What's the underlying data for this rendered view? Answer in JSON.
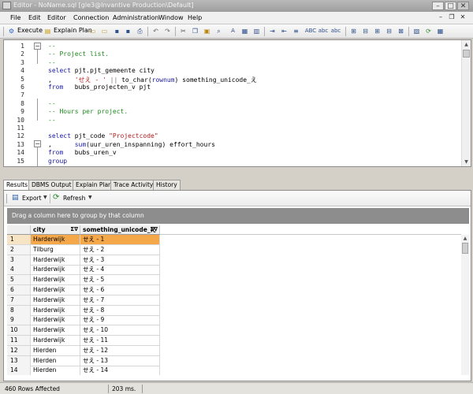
{
  "window": {
    "title": "Editor - NoName.sql [gle3@Invantive Production\\Default]"
  },
  "menu": [
    "File",
    "Edit",
    "Editor",
    "Connection",
    "Administration",
    "Window",
    "Help"
  ],
  "toolbar": {
    "execute_label": "Execute",
    "explain_label": "Explain Plan"
  },
  "editor": {
    "lines": [
      {
        "n": "1",
        "html": "<span class='cm'>--</span>"
      },
      {
        "n": "2",
        "html": "<span class='cm'>-- Project list.</span>"
      },
      {
        "n": "3",
        "html": "<span class='cm'>--</span>"
      },
      {
        "n": "4",
        "html": "<span class='kw'>select</span> pjt.pjt_gemeente city"
      },
      {
        "n": "5",
        "html": ",      <span class='st'>'せえ - '</span> <span class='op'>||</span> to_char(<span class='kw'>rownum</span>) something_unicode_え"
      },
      {
        "n": "6",
        "html": "<span class='kw'>from</span>   bubs_projecten_v pjt"
      },
      {
        "n": "7",
        "html": ""
      },
      {
        "n": "8",
        "html": "<span class='cm'>--</span>"
      },
      {
        "n": "9",
        "html": "<span class='cm'>-- Hours per project.</span>"
      },
      {
        "n": "10",
        "html": "<span class='cm'>--</span>"
      },
      {
        "n": "11",
        "html": ""
      },
      {
        "n": "12",
        "html": "<span class='kw'>select</span> pjt_code <span class='st'>\"Projectcode\"</span>"
      },
      {
        "n": "13",
        "html": ",      <span class='kw'>sum</span>(uur_uren_inspanning) effort_hours"
      },
      {
        "n": "14",
        "html": "<span class='kw'>from</span>   bubs_uren_v"
      },
      {
        "n": "15",
        "html": "<span class='kw'>group</span>"
      }
    ]
  },
  "tabs": [
    "Results",
    "DBMS Output",
    "Explain Plan",
    "Trace Activity",
    "History"
  ],
  "results": {
    "export_label": "Export",
    "refresh_label": "Refresh",
    "groupby_hint": "Drag a column here to group by that column",
    "columns": [
      "city",
      "something_unicode_え"
    ],
    "rows": [
      {
        "idx": "1",
        "city": "Harderwijk",
        "uni": "せえ - 1"
      },
      {
        "idx": "2",
        "city": "Tilburg",
        "uni": "せえ - 2"
      },
      {
        "idx": "3",
        "city": "Harderwijk",
        "uni": "せえ - 3"
      },
      {
        "idx": "4",
        "city": "Harderwijk",
        "uni": "せえ - 4"
      },
      {
        "idx": "5",
        "city": "Harderwijk",
        "uni": "せえ - 5"
      },
      {
        "idx": "6",
        "city": "Harderwijk",
        "uni": "せえ - 6"
      },
      {
        "idx": "7",
        "city": "Harderwijk",
        "uni": "せえ - 7"
      },
      {
        "idx": "8",
        "city": "Harderwijk",
        "uni": "せえ - 8"
      },
      {
        "idx": "9",
        "city": "Harderwijk",
        "uni": "せえ - 9"
      },
      {
        "idx": "10",
        "city": "Harderwijk",
        "uni": "せえ - 10"
      },
      {
        "idx": "11",
        "city": "Harderwijk",
        "uni": "せえ - 11"
      },
      {
        "idx": "12",
        "city": "Hierden",
        "uni": "せえ - 12"
      },
      {
        "idx": "13",
        "city": "Hierden",
        "uni": "せえ - 13"
      },
      {
        "idx": "14",
        "city": "Hierden",
        "uni": "せえ - 14"
      }
    ]
  },
  "status": {
    "rows_affected": "460 Rows Affected",
    "elapsed": "203 ms."
  },
  "colors": {
    "selected_row": "#f5a84a",
    "keyword": "#1a1aa6",
    "comment": "#1f8a1f",
    "string": "#b01c1c"
  }
}
